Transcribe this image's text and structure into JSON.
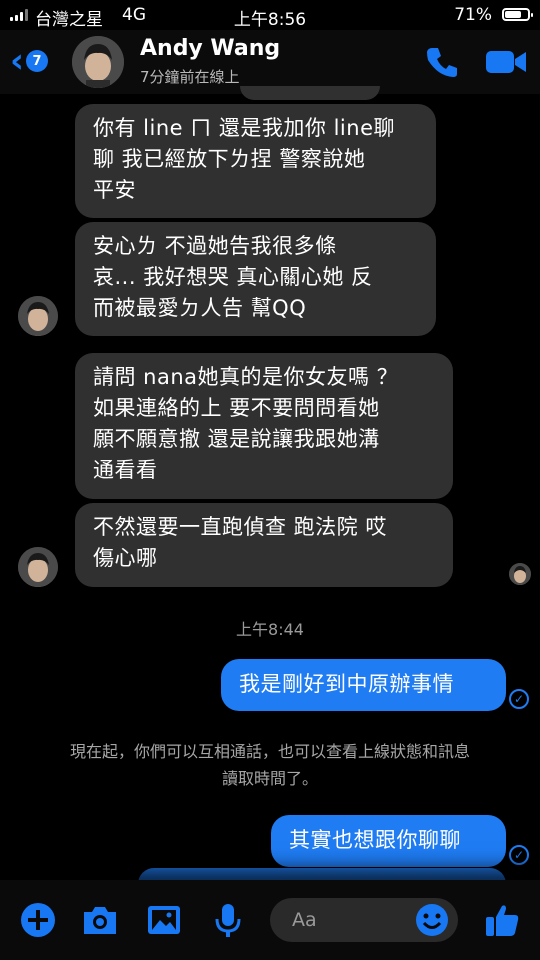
{
  "status_bar": {
    "carrier": "台灣之星",
    "network": "4G",
    "time": "上午8:56",
    "battery": "71%",
    "battery_level": 0.71
  },
  "header": {
    "back_badge": "7",
    "contact_name": "Andy Wang",
    "contact_status": "7分鐘前在線上",
    "icons": [
      "back-chevron-icon",
      "phone-icon",
      "video-camera-icon"
    ],
    "accent_color": "#1877f2"
  },
  "messages": [
    {
      "direction": "in",
      "text": "你有 line ㄇ  還是我加你 line聊\n聊  我已經放下ㄌ捏  警察說她\n平安"
    },
    {
      "direction": "in",
      "text": "安心ㄌ  不過她告我很多條\n哀... 我好想哭  真心關心她  反\n而被最愛ㄉ人告   幫QQ"
    },
    {
      "direction": "in",
      "text": "請問 nana她真的是你女友嗎 ？\n如果連絡的上  要不要問問看她\n願不願意撤  還是說讓我跟她溝\n通看看"
    },
    {
      "direction": "in",
      "text": "不然還要一直跑偵查 跑法院 哎\n傷心哪"
    },
    {
      "direction": "out",
      "text": "我是剛好到中原辦事情"
    },
    {
      "direction": "out",
      "text": "其實也想跟你聊聊"
    }
  ],
  "timestamp": "上午8:44",
  "system_message": "現在起，你們可以互相通話，也可以查看上線狀態和訊息\n讀取時間了。",
  "composer": {
    "placeholder": "Aa",
    "tools": [
      "plus-icon",
      "camera-icon",
      "gallery-icon",
      "microphone-icon",
      "emoji-icon",
      "thumbs-up-icon"
    ]
  },
  "colors": {
    "background": "#000000",
    "incoming_bubble": "#303030",
    "outgoing_bubble": "#1f7cf2",
    "accent": "#1877f2"
  }
}
